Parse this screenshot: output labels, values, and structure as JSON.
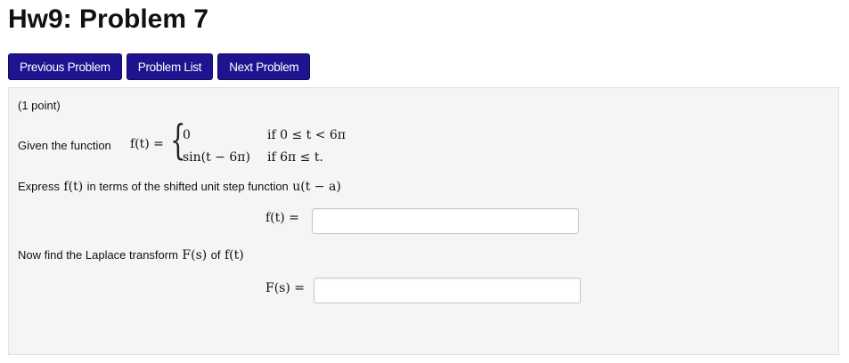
{
  "page": {
    "title": "Hw9: Problem 7"
  },
  "nav": {
    "previous_label": "Previous Problem",
    "list_label": "Problem List",
    "next_label": "Next Problem"
  },
  "problem": {
    "points": "(1 point)",
    "given_prefix": "Given the function",
    "f_label": "f(t) =",
    "piecewise": [
      {
        "value": "0",
        "condition": "if 0 ≤ t < 6π"
      },
      {
        "value": "sin(t − 6π)",
        "condition": "if 6π ≤ t."
      }
    ],
    "express_prefix": "Express",
    "express_f": "f(t)",
    "express_mid": "in terms of the shifted unit step function",
    "express_u": "u(t − a)",
    "answer1_label": "f(t) =",
    "answer1_value": "",
    "laplace_prefix": "Now find the Laplace transform",
    "laplace_F": "F(s)",
    "laplace_of": "of",
    "laplace_f": "f(t)",
    "answer2_label": "F(s) =",
    "answer2_value": ""
  },
  "colors": {
    "button_bg": "#1f148f",
    "panel_bg": "#f5f5f5"
  }
}
